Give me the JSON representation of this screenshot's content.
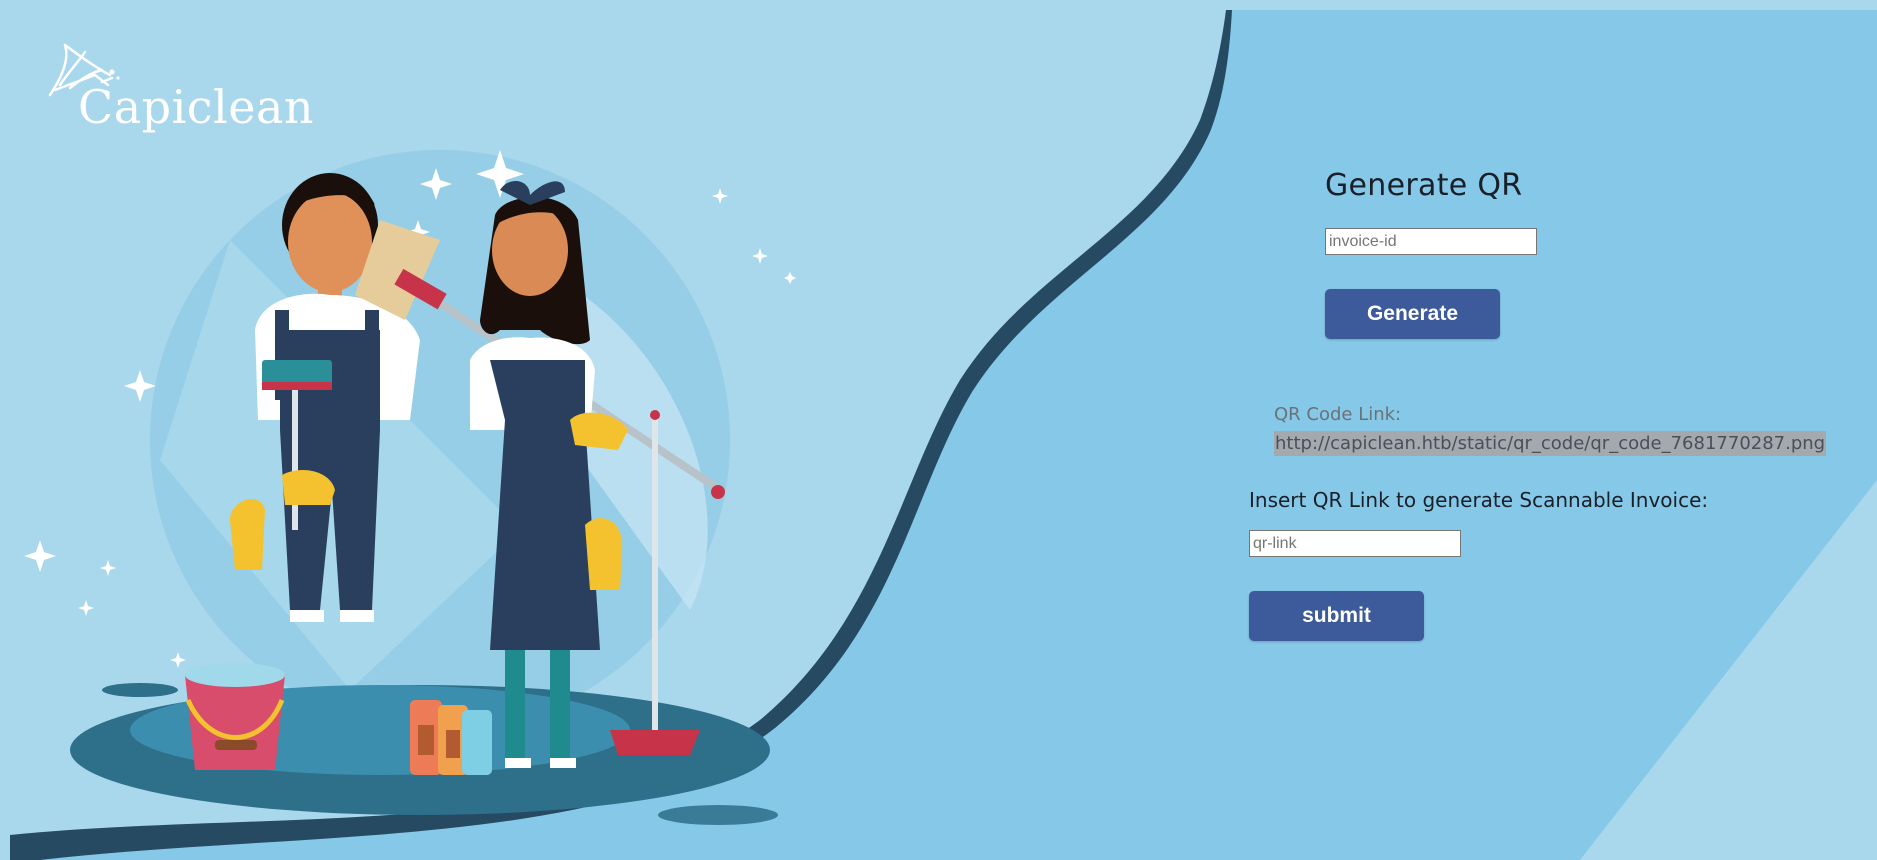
{
  "brand": {
    "name": "Capiclean",
    "icon": "feather-duster-icon"
  },
  "generator": {
    "title": "Generate QR",
    "invoice_placeholder": "invoice-id",
    "generate_label": "Generate"
  },
  "result": {
    "label": "QR Code Link:",
    "url": "http://capiclean.htb/static/qr_code/qr_code_7681770287.png"
  },
  "scannable": {
    "label": "Insert QR Link to generate Scannable Invoice:",
    "qr_placeholder": "qr-link",
    "submit_label": "submit"
  },
  "colors": {
    "background_light": "#a9d8ec",
    "background_panel": "#86c8e8",
    "button": "#3d5a9a",
    "wave_dark": "#274a63"
  }
}
